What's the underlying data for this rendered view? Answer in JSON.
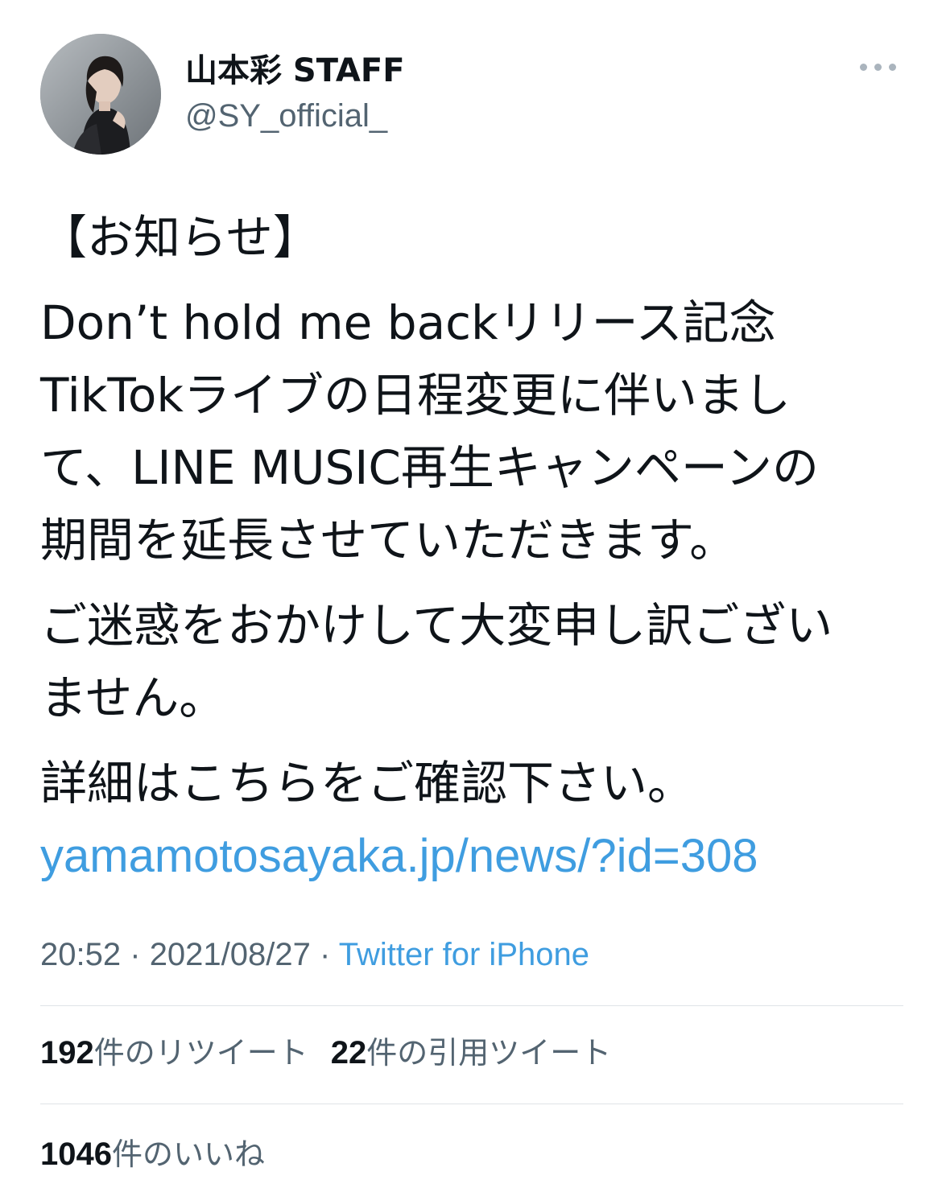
{
  "author": {
    "display_name": "山本彩 STAFF",
    "handle": "@SY_official_"
  },
  "more_icon": "more-horizontal-icon",
  "tweet": {
    "heading": "【お知らせ】",
    "para1_lines": [
      "Don’t hold me backリリース記念",
      "TikTokライブの日程変更に伴いまし",
      "て、LINE MUSIC再生キャンペーンの",
      "期間を延長させていただきます。"
    ],
    "para2_lines": [
      "ご迷惑をおかけして大変申し訳ござい",
      "ません。"
    ],
    "para3": "詳細はこちらをご確認下さい。",
    "link": "yamamotosayaka.jp/news/?id=308"
  },
  "meta": {
    "time": "20:52",
    "separator": "·",
    "date": "2021/08/27",
    "source": "Twitter for iPhone"
  },
  "stats": {
    "retweets_count": "192",
    "retweets_label": "件のリツイート",
    "quotes_count": "22",
    "quotes_label": "件の引用ツイート",
    "likes_count": "1046",
    "likes_label": "件のいいね"
  },
  "colors": {
    "link": "#3f9de0",
    "secondary_text": "#536471",
    "divider": "#dfe3e7"
  }
}
